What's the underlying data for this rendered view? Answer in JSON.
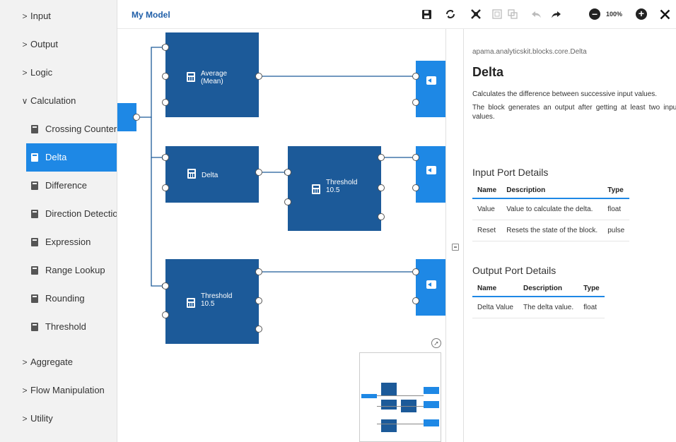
{
  "sidebar": {
    "categories": {
      "input": {
        "label": "Input",
        "chevron": ">"
      },
      "output": {
        "label": "Output",
        "chevron": ">"
      },
      "logic": {
        "label": "Logic",
        "chevron": ">"
      },
      "calculation": {
        "label": "Calculation",
        "chevron": "∨"
      },
      "aggregate": {
        "label": "Aggregate",
        "chevron": ">"
      },
      "flow_manipulation": {
        "label": "Flow Manipulation",
        "chevron": ">"
      },
      "utility": {
        "label": "Utility",
        "chevron": ">"
      }
    },
    "calculation_items": [
      {
        "label": "Crossing Counter"
      },
      {
        "label": "Delta",
        "selected": true
      },
      {
        "label": "Difference"
      },
      {
        "label": "Direction Detection"
      },
      {
        "label": "Expression"
      },
      {
        "label": "Range Lookup"
      },
      {
        "label": "Rounding"
      },
      {
        "label": "Threshold"
      }
    ],
    "item_icon": "calculator-icon",
    "accent_color": "#1e88e5"
  },
  "header": {
    "model_name": "My Model",
    "zoom_level": "100%",
    "toolbar_icons": [
      "save-icon",
      "refresh-icon",
      "delete-icon",
      "select-icon",
      "select-all-icon",
      "undo-icon",
      "redo-icon",
      "zoom-out-icon",
      "zoom-in-icon",
      "close-icon"
    ]
  },
  "canvas": {
    "blocks": {
      "average": {
        "line1": "Average",
        "line2": "(Mean)",
        "icon": "average-icon"
      },
      "delta": {
        "line1": "Delta",
        "icon": "calculator-icon"
      },
      "threshold_a": {
        "line1": "Threshold",
        "line2": "10.5",
        "icon": "calculator-icon"
      },
      "threshold_b": {
        "line1": "Threshold",
        "line2": "10.5",
        "icon": "calculator-icon"
      }
    },
    "block_color": "#1c5a99",
    "io_block_color": "#1e88e5",
    "output_block_icon": "output-icon",
    "minimap_icon": "compass-icon"
  },
  "details": {
    "path": "apama.analyticskit.blocks.core.Delta",
    "title": "Delta",
    "description_1": "Calculates the difference between successive input values.",
    "description_2": "The block generates an output after getting at least two input values.",
    "input_section": "Input Port Details",
    "input_headers": {
      "name": "Name",
      "description": "Description",
      "type": "Type"
    },
    "input_rows": [
      {
        "name": "Value",
        "description": "Value to calculate the delta.",
        "type": "float"
      },
      {
        "name": "Reset",
        "description": "Resets the state of the block.",
        "type": "pulse"
      }
    ],
    "output_section": "Output Port Details",
    "output_headers": {
      "name": "Name",
      "description": "Description",
      "type": "Type"
    },
    "output_rows": [
      {
        "name": "Delta Value",
        "description": "The delta value.",
        "type": "float"
      }
    ]
  }
}
